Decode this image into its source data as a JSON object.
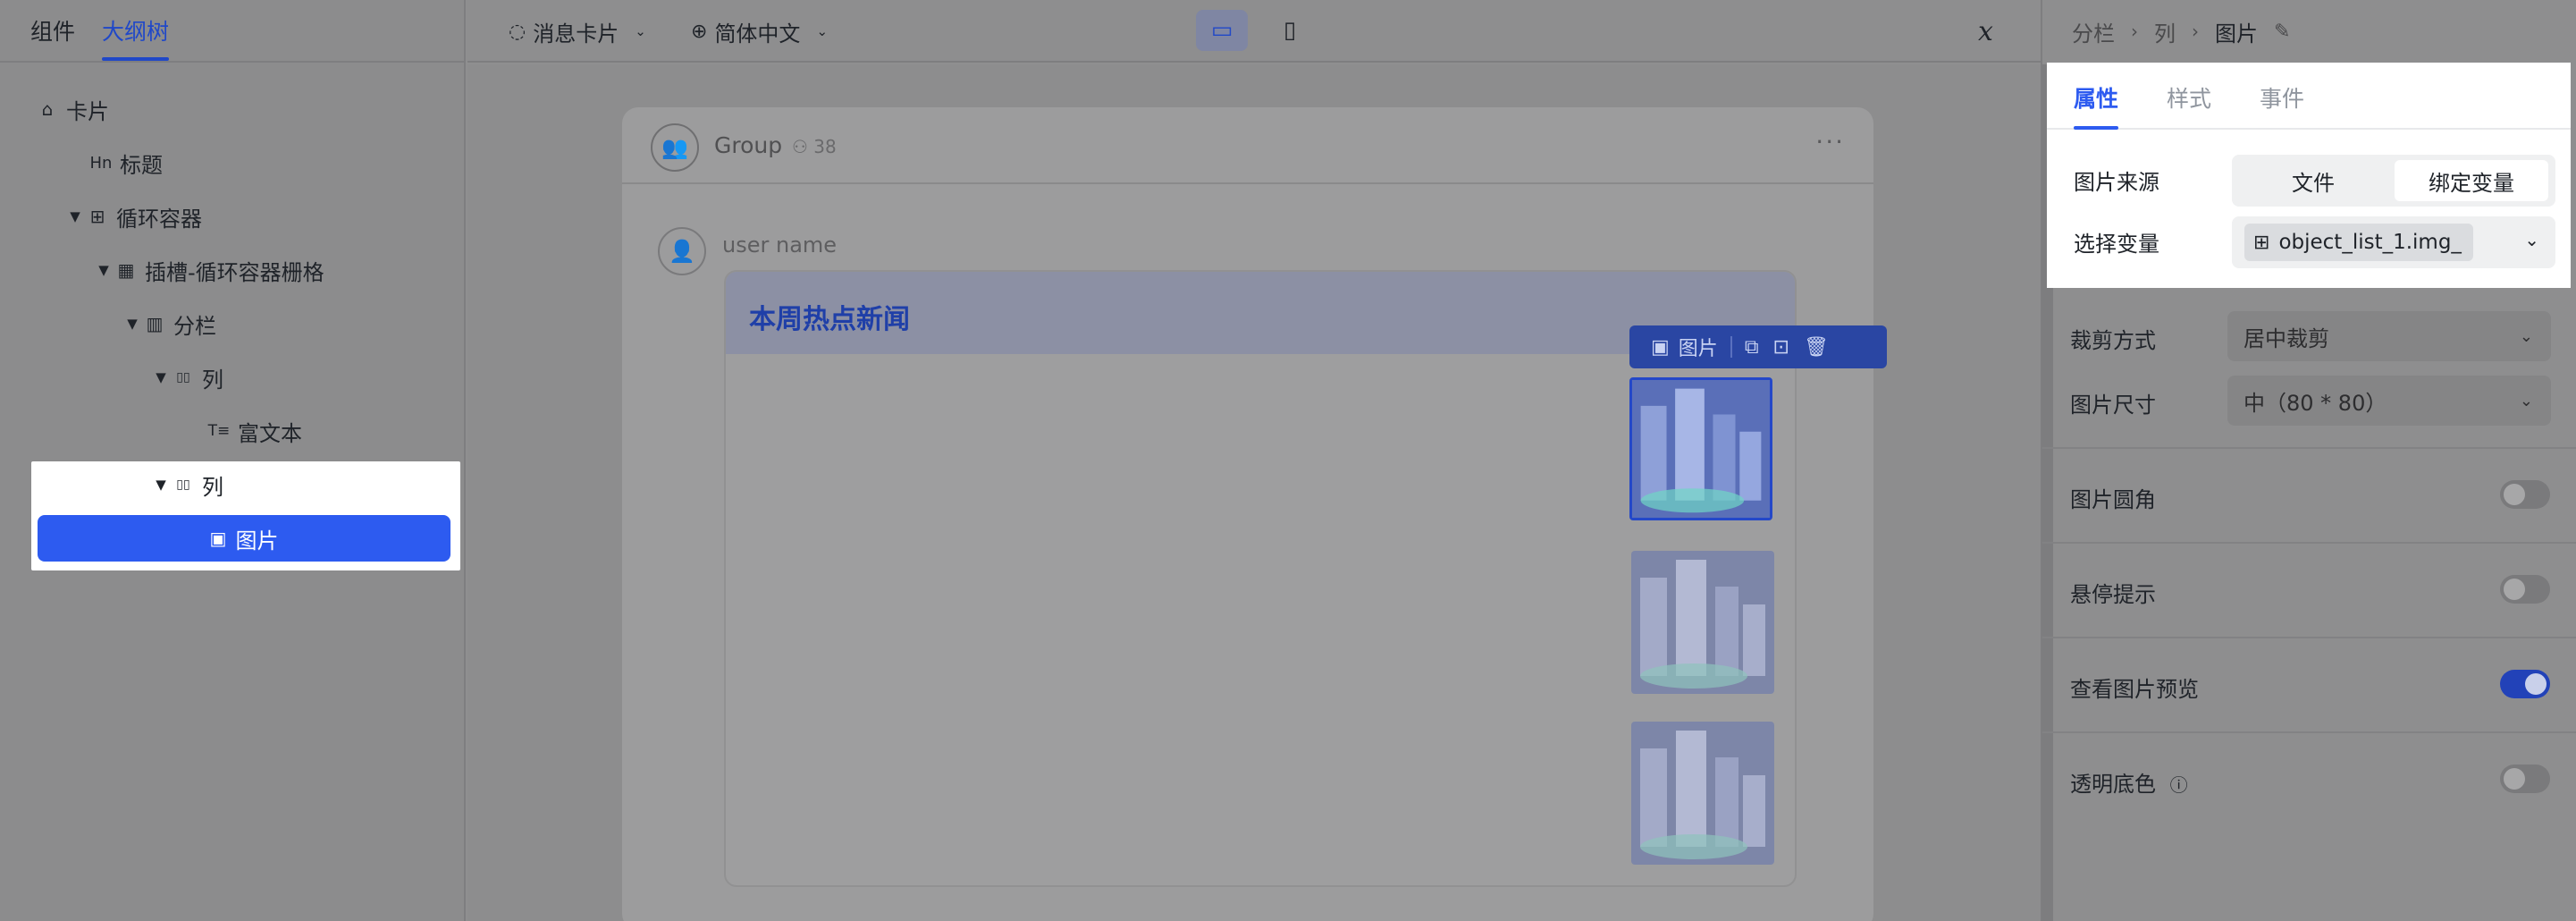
{
  "left_panel": {
    "tabs": [
      {
        "label": "组件"
      },
      {
        "label": "大纲树"
      }
    ],
    "tree": [
      {
        "label": "卡片",
        "icon": "card-icon",
        "glyph": "⌂"
      },
      {
        "label": "标题",
        "icon": "heading-icon",
        "glyph": "Hn"
      },
      {
        "label": "循环容器",
        "icon": "loop-container-icon",
        "glyph": "⊞"
      },
      {
        "label": "插槽-循环容器栅格",
        "icon": "grid-slot-icon",
        "glyph": "▦"
      },
      {
        "label": "分栏",
        "icon": "columns-icon",
        "glyph": "▥"
      },
      {
        "label": "列",
        "icon": "column-icon",
        "glyph": "▯▯"
      },
      {
        "label": "富文本",
        "icon": "rich-text-icon",
        "glyph": "T≡"
      },
      {
        "label": "列",
        "icon": "column-icon",
        "glyph": "▯▯"
      },
      {
        "label": "图片",
        "icon": "image-icon",
        "glyph": "🖼"
      }
    ],
    "selected": "图片"
  },
  "toolbar": {
    "card_type": "消息卡片",
    "language": "简体中文",
    "devices": [
      "desktop-icon",
      "mobile-icon"
    ],
    "variable_icon": "𝑥"
  },
  "canvas": {
    "group_name": "Group",
    "member_count": "38",
    "user_name": "user name",
    "card_title": "本周热点新闻",
    "image_toolbar": {
      "label": "图片",
      "actions": [
        "copy-icon",
        "duplicate-icon",
        "delete-icon"
      ]
    }
  },
  "right_panel": {
    "breadcrumb": [
      "分栏",
      "列",
      "图片"
    ],
    "tabs": [
      {
        "label": "属性"
      },
      {
        "label": "样式"
      },
      {
        "label": "事件"
      }
    ],
    "image_source": {
      "label": "图片来源",
      "options": [
        "文件",
        "绑定变量"
      ],
      "selected": "绑定变量"
    },
    "select_variable": {
      "label": "选择变量",
      "value": "object_list_1.img_"
    },
    "crop_mode": {
      "label": "裁剪方式",
      "value": "居中裁剪"
    },
    "image_size": {
      "label": "图片尺寸",
      "value": "中（80 * 80）"
    },
    "rounded_corner": {
      "label": "图片圆角",
      "on": false
    },
    "hover_tip": {
      "label": "悬停提示",
      "on": false
    },
    "preview": {
      "label": "查看图片预览",
      "on": true
    },
    "transparent_bg": {
      "label": "透明底色",
      "on": false
    }
  },
  "colors": {
    "accent": "#2d5bf0",
    "selected_bg": "#ffffff"
  }
}
